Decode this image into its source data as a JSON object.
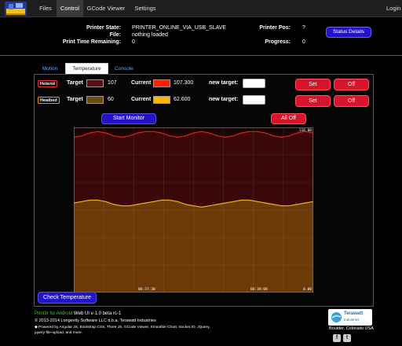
{
  "nav": {
    "tabs": [
      "Files",
      "Control",
      "GCode Viewer",
      "Settings"
    ],
    "login": "Login"
  },
  "status": {
    "printer_state_label": "Printer State:",
    "printer_state_value": "PRINTER_ONLINE_VIA_USB_SLAVE",
    "file_label": "File:",
    "file_value": "nothing loaded",
    "time_label": "Print Time Remaining:",
    "time_value": "0",
    "pos_label": "Printer Pos:",
    "pos_value": "?",
    "progress_label": "Progress:",
    "progress_value": "0",
    "details_button": "Status Details"
  },
  "tabs": [
    "Motion",
    "Temperature",
    "Console"
  ],
  "hotend": {
    "badge": "Hotend",
    "target_label": "Target",
    "target_value": "107",
    "target_color": "#5a1010",
    "current_label": "Current",
    "current_value": "107.300",
    "current_color": "#ff2200",
    "new_target_label": "new target:",
    "set_button": "Set",
    "off_button": "Off"
  },
  "heatbed": {
    "badge": "Heatbed",
    "target_label": "Target",
    "target_value": "60",
    "target_color": "#6b4a14",
    "current_label": "Current",
    "current_value": "62.600",
    "current_color": "#ffb300",
    "new_target_label": "new target:",
    "set_button": "Set",
    "off_button": "Off"
  },
  "buttons": {
    "start_monitor": "Start Monitor",
    "all_off": "All Off",
    "check_temperature": "Check Temperature"
  },
  "chart_data": {
    "type": "area",
    "title": "",
    "xlabel": "",
    "ylabel": "",
    "ylim": [
      0,
      118
    ],
    "y_tick_labels": [
      "118.00",
      "0.00"
    ],
    "x_tick_labels": [
      "06:37:30",
      "06:38:00"
    ],
    "grid": true,
    "series": [
      {
        "color": "#e0201a",
        "fill": "#3a0808",
        "x": [
          0,
          1,
          2,
          3,
          4,
          5,
          6,
          7,
          8,
          9,
          10,
          11,
          12,
          13,
          14,
          15,
          16,
          17,
          18,
          19,
          20,
          21,
          22,
          23,
          24,
          25,
          26,
          27,
          28,
          29,
          30
        ],
        "values": [
          111,
          112,
          114,
          115,
          114,
          112,
          111,
          112,
          114,
          115,
          115,
          114,
          112,
          111,
          112,
          114,
          115,
          114,
          112,
          111,
          112,
          114,
          115,
          115,
          114,
          112,
          111,
          112,
          114,
          115,
          114
        ]
      },
      {
        "color": "#f0b020",
        "fill": "#6b3a06",
        "x": [
          0,
          1,
          2,
          3,
          4,
          5,
          6,
          7,
          8,
          9,
          10,
          11,
          12,
          13,
          14,
          15,
          16,
          17,
          18,
          19,
          20,
          21,
          22,
          23,
          24,
          25,
          26,
          27,
          28,
          29,
          30
        ],
        "values": [
          64,
          65,
          66,
          66,
          65,
          63,
          62,
          62,
          63,
          64,
          65,
          66,
          66,
          65,
          63,
          62,
          61,
          62,
          63,
          64,
          65,
          66,
          66,
          65,
          64,
          63,
          62,
          62,
          63,
          64,
          65
        ]
      }
    ]
  },
  "footer": {
    "app_name": "Print3r for Android",
    "version": "Web UI v-1.0 beta rc-1",
    "copyright": "© 2013-2014 Longevity Software LLC d.b.a. Terawatt Industries",
    "powered": "◆ Powered by Angular JS, Bootstrap CSS, Three JS, GCode Viewer, Smoothie Chart, Socket.IO, JQuery,",
    "powered2": "jquery-file-upload, and more.",
    "company": "Terawatt",
    "company_sub": "Industries",
    "location": "Boulder, Colorado  USA"
  }
}
